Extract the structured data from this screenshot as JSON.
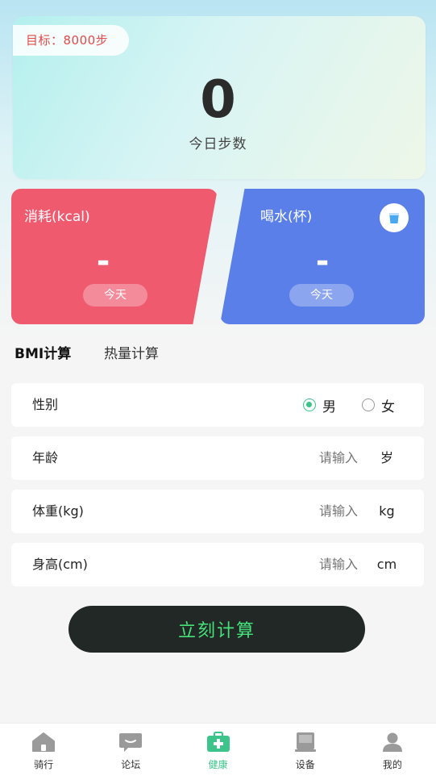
{
  "goal": {
    "label": "目标：8000步"
  },
  "steps": {
    "value": "0",
    "label": "今日步数"
  },
  "calorie_card": {
    "title": "消耗(kcal)",
    "value": "-",
    "period": "今天"
  },
  "water_card": {
    "title": "喝水(杯)",
    "value": "-",
    "period": "今天",
    "icon": "cup-icon"
  },
  "tabs": [
    {
      "label": "BMI计算",
      "active": true
    },
    {
      "label": "热量计算",
      "active": false
    }
  ],
  "form": {
    "gender": {
      "label": "性别",
      "options": [
        {
          "label": "男",
          "selected": true
        },
        {
          "label": "女",
          "selected": false
        }
      ]
    },
    "age": {
      "label": "年龄",
      "placeholder": "请输入",
      "unit": "岁"
    },
    "weight": {
      "label": "体重(kg)",
      "placeholder": "请输入",
      "unit": "kg"
    },
    "height": {
      "label": "身高(cm)",
      "placeholder": "请输入",
      "unit": "cm"
    }
  },
  "calculate_button": {
    "label": "立刻计算"
  },
  "tabbar": [
    {
      "label": "骑行",
      "icon": "home-icon",
      "active": false
    },
    {
      "label": "论坛",
      "icon": "chat-icon",
      "active": false
    },
    {
      "label": "健康",
      "icon": "medical-kit-icon",
      "active": true
    },
    {
      "label": "设备",
      "icon": "device-icon",
      "active": false
    },
    {
      "label": "我的",
      "icon": "person-icon",
      "active": false
    }
  ],
  "colors": {
    "accent": "#3cc48a",
    "calorie": "#ef5a6f",
    "water": "#5b7fe8",
    "goal_text": "#e04a4a",
    "button_bg": "#222826",
    "button_text": "#45e27a"
  }
}
